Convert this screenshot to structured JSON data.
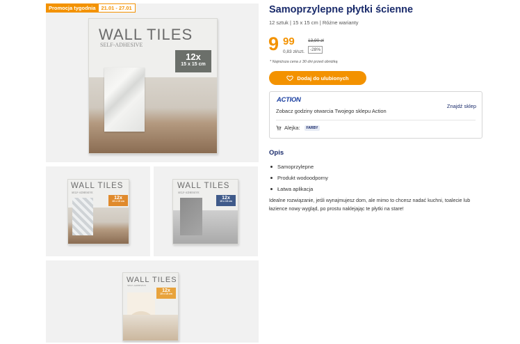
{
  "promo": {
    "label": "Promocja tygodnia",
    "dates": "21.01 - 27.01"
  },
  "gallery": [
    {
      "brand": "WALL TILES",
      "sub": "SELF-ADHESIVE",
      "tag": "12x",
      "size": "15 x 15 cm",
      "tag_color": "#6b6f6a"
    },
    {
      "brand": "WALL TILES",
      "sub": "SELF-ADHESIVE",
      "tag": "12x",
      "size": "15 x 15 cm",
      "tag_color": "#e08a2c"
    },
    {
      "brand": "WALL TILES",
      "sub": "SELF-ADHESIVE",
      "tag": "12x",
      "size": "15 x 15 cm",
      "tag_color": "#3f5a8a"
    },
    {
      "brand": "WALL TILES",
      "sub": "SELF-ADHESIVE",
      "tag": "12x",
      "size": "15 x 15 cm",
      "tag_color": "#e8a33c"
    }
  ],
  "product": {
    "title": "Samoprzylepne płytki ścienne",
    "subtitle": "12 sztuk | 15 x 15 cm | Różne warianty",
    "price_main": "9",
    "price_cents": "99",
    "unit_price": "0,83 zł/szt.",
    "old_price": "13,90 zł",
    "discount": "-28%",
    "note": "* Najniższa cena z 30 dni przed obniżką",
    "fav_button": "Dodaj do ulubionych"
  },
  "store": {
    "logo": "ACTION",
    "text": "Zobacz godziny otwarcia Twojego sklepu Action",
    "link": "Znajdź sklep",
    "aisle_label": "Alejka:",
    "aisle_value": "FARBY"
  },
  "description": {
    "title": "Opis",
    "bullets": [
      "Samoprzylepne",
      "Produkt wodoodporny",
      "Łatwa aplikacja"
    ],
    "text": "Idealne rozwiązanie, jeśli wynajmujesz dom, ale mimo to chcesz nadać kuchni, toalecie lub łazience nowy wygląd, po prostu naklejając te płytki na stare!"
  },
  "colors": {
    "accent": "#f39200",
    "brand_navy": "#1a2b6b"
  },
  "icons": {
    "fav": "heart-icon",
    "aisle": "cart-icon"
  }
}
